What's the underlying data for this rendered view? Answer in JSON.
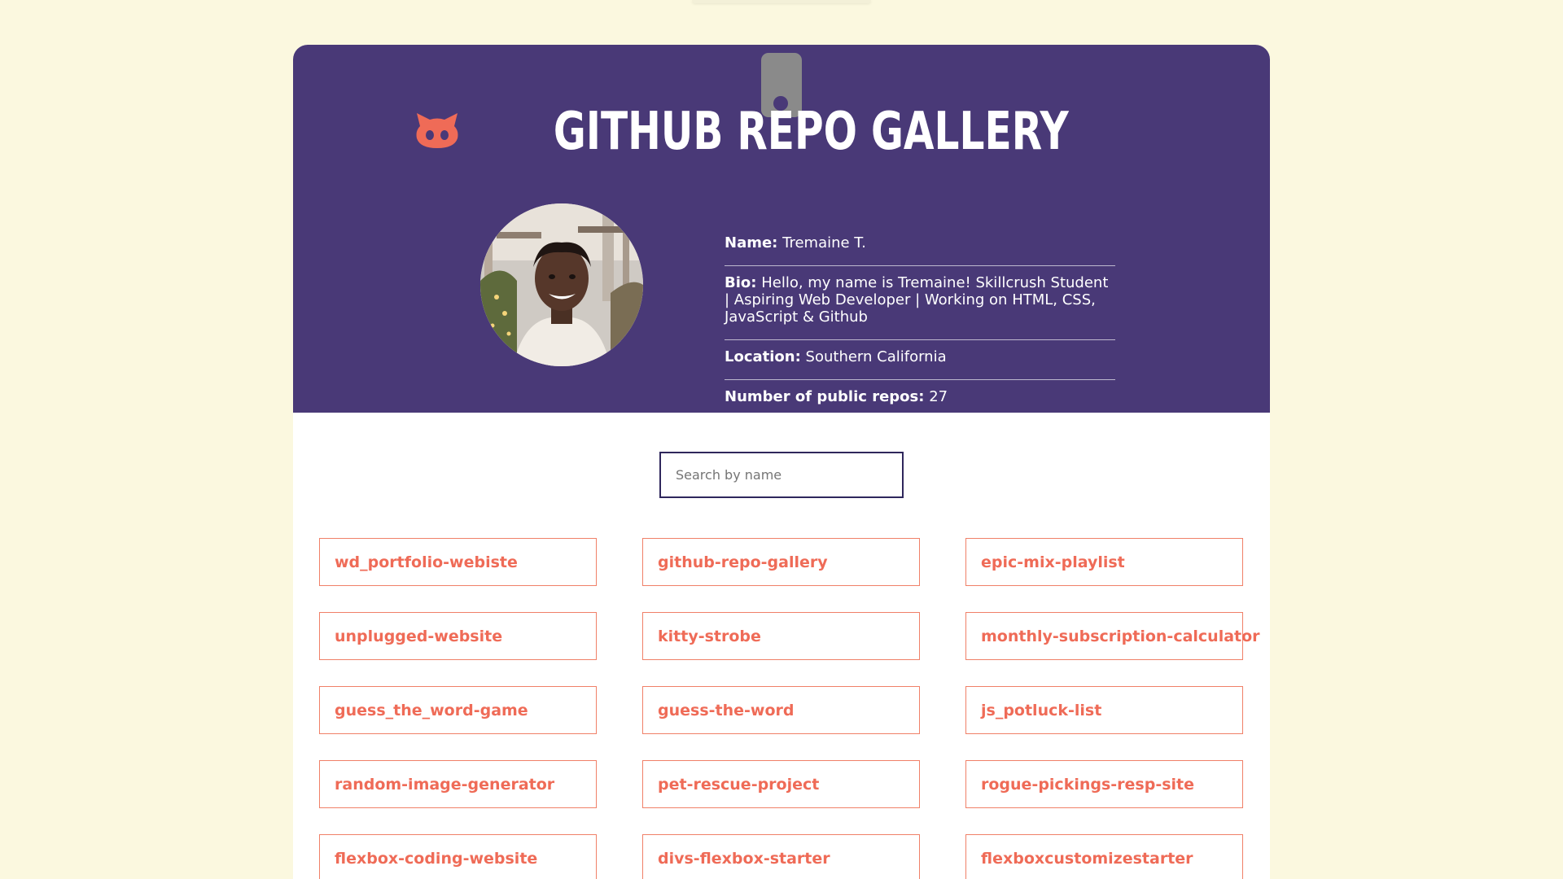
{
  "header": {
    "title": "GITHUB REPO GALLERY",
    "icon": "github-octocat-icon",
    "accent": "#ef6b57",
    "background": "#493977"
  },
  "profile": {
    "avatar_alt": "profile photo",
    "name_label": "Name:",
    "name": "Tremaine T.",
    "bio_label": "Bio:",
    "bio": "Hello, my name is Tremaine! Skillcrush Student | Aspiring Web Developer | Working on HTML, CSS, JavaScript & Github",
    "location_label": "Location:",
    "location": "Southern California",
    "repos_label": "Number of public repos:",
    "repos": "27"
  },
  "search": {
    "placeholder": "Search by name",
    "value": ""
  },
  "repos": [
    "wd_portfolio-webiste",
    "github-repo-gallery",
    "epic-mix-playlist",
    "unplugged-website",
    "kitty-strobe",
    "monthly-subscription-calculator",
    "guess_the_word-game",
    "guess-the-word",
    "js_potluck-list",
    "random-image-generator",
    "pet-rescue-project",
    "rogue-pickings-resp-site",
    "flexbox-coding-website",
    "divs-flexbox-starter",
    "flexboxcustomizestarter"
  ]
}
